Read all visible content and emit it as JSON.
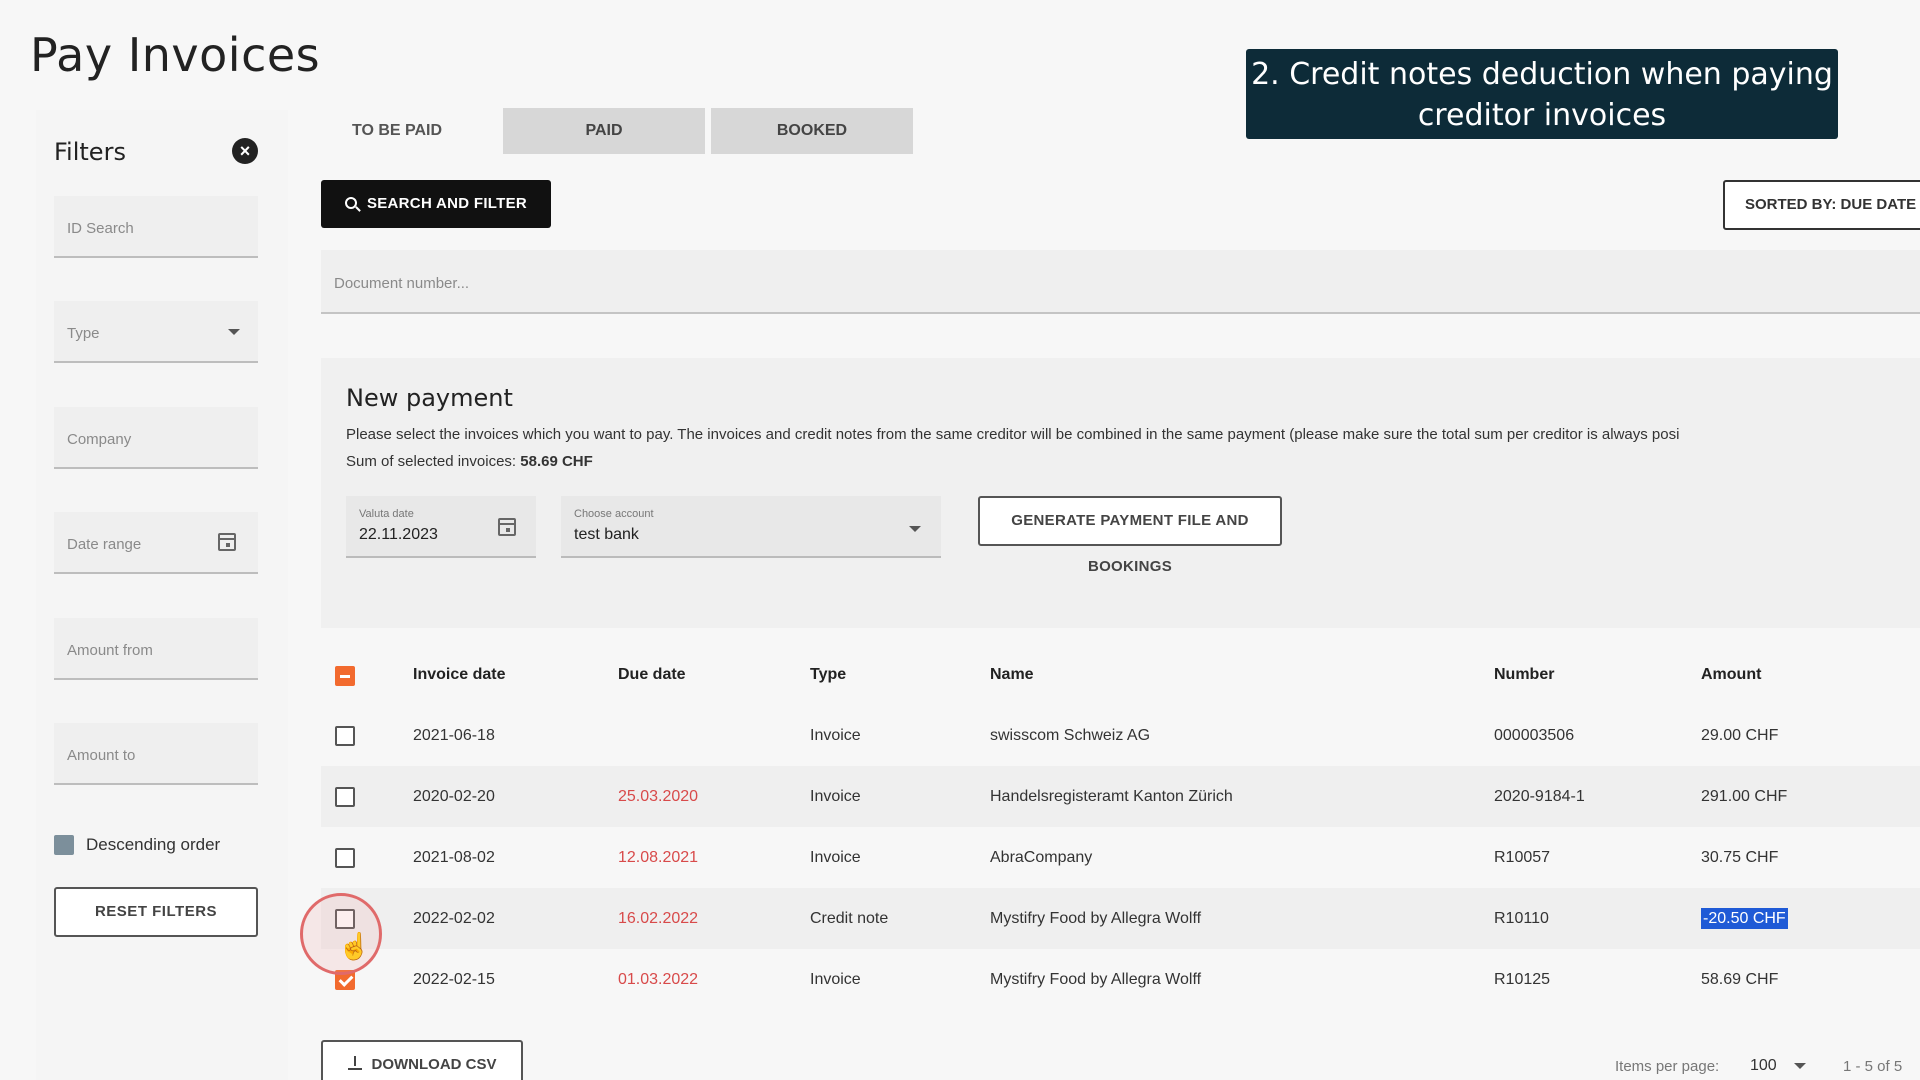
{
  "page_title": "Pay Invoices",
  "callout": "2. Credit notes deduction when paying creditor invoices",
  "filters": {
    "title": "Filters",
    "id_search": "ID Search",
    "type": "Type",
    "company": "Company",
    "date_range": "Date range",
    "amount_from": "Amount from",
    "amount_to": "Amount to",
    "descending": "Descending order",
    "reset": "RESET FILTERS"
  },
  "tabs": [
    "TO BE PAID",
    "PAID",
    "BOOKED"
  ],
  "toolbar": {
    "search": "SEARCH AND FILTER",
    "sorted_by": "SORTED BY: DUE DATE",
    "doc_placeholder": "Document number..."
  },
  "new_payment": {
    "title": "New payment",
    "description": "Please select the invoices which you want to pay. The invoices and credit notes from the same creditor will be combined in the same payment (please make sure the total sum per creditor is always posi",
    "sum_label": "Sum of selected invoices:",
    "sum_value": "58.69 CHF",
    "valuta_label": "Valuta date",
    "valuta_value": "22.11.2023",
    "account_label": "Choose account",
    "account_value": "test bank",
    "generate": "GENERATE PAYMENT FILE AND BOOKINGS"
  },
  "table": {
    "headers": {
      "invoice_date": "Invoice date",
      "due_date": "Due date",
      "type": "Type",
      "name": "Name",
      "number": "Number",
      "amount": "Amount"
    },
    "rows": [
      {
        "invoice_date": "2021-06-18",
        "due_date": "",
        "type": "Invoice",
        "name": "swisscom Schweiz AG",
        "number": "000003506",
        "amount": "29.00 CHF",
        "checked": false
      },
      {
        "invoice_date": "2020-02-20",
        "due_date": "25.03.2020",
        "type": "Invoice",
        "name": "Handelsregisteramt Kanton Zürich",
        "number": "2020-9184-1",
        "amount": "291.00 CHF",
        "checked": false
      },
      {
        "invoice_date": "2021-08-02",
        "due_date": "12.08.2021",
        "type": "Invoice",
        "name": "AbraCompany",
        "number": "R10057",
        "amount": "30.75 CHF",
        "checked": false
      },
      {
        "invoice_date": "2022-02-02",
        "due_date": "16.02.2022",
        "type": "Credit note",
        "name": "Mystifry Food by Allegra Wolff",
        "number": "R10110",
        "amount": "-20.50 CHF",
        "checked": false
      },
      {
        "invoice_date": "2022-02-15",
        "due_date": "01.03.2022",
        "type": "Invoice",
        "name": "Mystifry Food by Allegra Wolff",
        "number": "R10125",
        "amount": "58.69 CHF",
        "checked": true
      }
    ]
  },
  "footer": {
    "download_csv": "DOWNLOAD CSV",
    "items_per_page_label": "Items per page:",
    "items_per_page": "100",
    "range": "1 - 5 of 5"
  },
  "colors": {
    "accent": "#f26a2e",
    "callout_bg": "#0d2b38",
    "overdue": "#d84a4a",
    "selection": "#1f5ad6"
  }
}
